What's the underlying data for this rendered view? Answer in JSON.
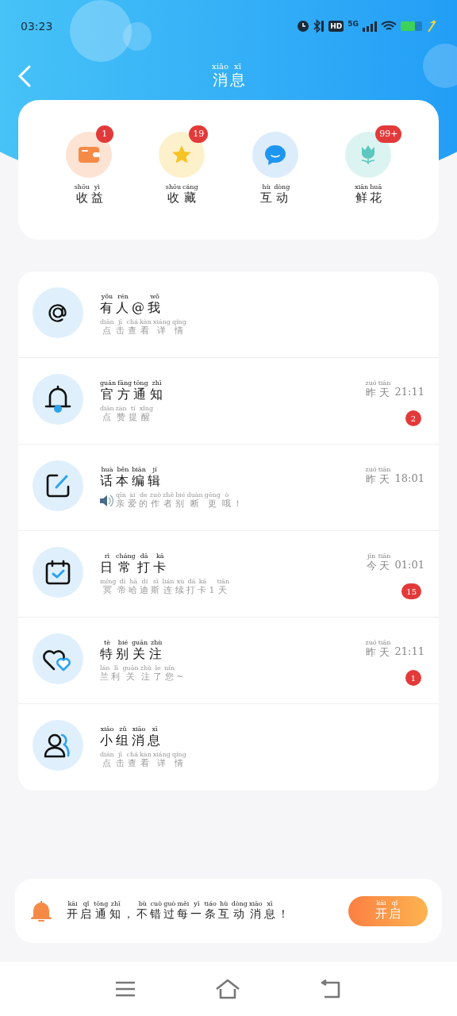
{
  "status_bar": {
    "time": "03:23",
    "hd": "HD",
    "network": "5G"
  },
  "header": {
    "title": [
      [
        "xiāo",
        "消"
      ],
      [
        "xī",
        "息"
      ]
    ]
  },
  "categories": [
    {
      "kind": "wallet",
      "label": [
        [
          "shōu",
          "收"
        ],
        [
          "yì",
          "益"
        ]
      ],
      "badge": "1"
    },
    {
      "kind": "star",
      "label": [
        [
          "shōu",
          "收"
        ],
        [
          "cáng",
          "藏"
        ]
      ],
      "badge": "19"
    },
    {
      "kind": "chat",
      "label": [
        [
          "hù",
          "互"
        ],
        [
          "dòng",
          "动"
        ]
      ]
    },
    {
      "kind": "flower",
      "label": [
        [
          "xiān",
          "鲜"
        ],
        [
          "huā",
          "花"
        ]
      ],
      "badge": "99+"
    }
  ],
  "messages": [
    {
      "kind": "at",
      "announcement": false,
      "title": [
        [
          "yǒu",
          "有"
        ],
        [
          "rén",
          "人"
        ],
        [
          "@"
        ],
        [
          "wǒ",
          "我"
        ]
      ],
      "subtitle": [
        [
          "diǎn",
          "点"
        ],
        [
          "jī",
          "击"
        ],
        [
          "chá",
          "查"
        ],
        [
          "kàn",
          "看"
        ],
        [
          "xiáng",
          "详"
        ],
        [
          "qíng",
          "情"
        ]
      ]
    },
    {
      "kind": "bell",
      "announcement": false,
      "title": [
        [
          "guān",
          "官"
        ],
        [
          "fāng",
          "方"
        ],
        [
          "tōng",
          "通"
        ],
        [
          "zhī",
          "知"
        ]
      ],
      "subtitle": [
        [
          "diǎn",
          "点"
        ],
        [
          "zàn",
          "赞"
        ],
        [
          "tí",
          "提"
        ],
        [
          "xǐng",
          "醒"
        ]
      ],
      "time": {
        "day": [
          [
            "zuó",
            "昨"
          ],
          [
            "tiān",
            "天"
          ]
        ],
        "clock": "21:11"
      },
      "badge": "2"
    },
    {
      "kind": "edit",
      "announcement": true,
      "title": [
        [
          "huà",
          "话"
        ],
        [
          "běn",
          "本"
        ],
        [
          "biān",
          "编"
        ],
        [
          "jí",
          "辑"
        ]
      ],
      "subtitle": [
        [
          "qīn",
          "亲"
        ],
        [
          "ài",
          "爱"
        ],
        [
          "de",
          "的"
        ],
        [
          "zuò",
          "作"
        ],
        [
          "zhě",
          "者"
        ],
        [
          "bié",
          "别"
        ],
        [
          "duàn",
          "断"
        ],
        [
          "gēng",
          "更"
        ],
        [
          "ò",
          "哦"
        ],
        [
          "！"
        ]
      ],
      "time": {
        "day": [
          [
            "zuó",
            "昨"
          ],
          [
            "tiān",
            "天"
          ]
        ],
        "clock": "18:01"
      }
    },
    {
      "kind": "calendar",
      "announcement": false,
      "title": [
        [
          "rì",
          "日"
        ],
        [
          "cháng",
          "常"
        ],
        [
          "dǎ",
          "打"
        ],
        [
          "kǎ",
          "卡"
        ]
      ],
      "subtitle": [
        [
          "míng",
          "冥"
        ],
        [
          "dì",
          "帝"
        ],
        [
          "hā",
          "哈"
        ],
        [
          "dí",
          "迪"
        ],
        [
          "sī",
          "斯"
        ],
        [
          "lián",
          "连"
        ],
        [
          "xù",
          "续"
        ],
        [
          "dǎ",
          "打"
        ],
        [
          "kǎ",
          "卡"
        ],
        [
          "1"
        ],
        [
          "tiān",
          "天"
        ]
      ],
      "time": {
        "day": [
          [
            "jīn",
            "今"
          ],
          [
            "tiān",
            "天"
          ]
        ],
        "clock": "01:01"
      },
      "badge": "15"
    },
    {
      "kind": "hearts",
      "announcement": false,
      "title": [
        [
          "tè",
          "特"
        ],
        [
          "bié",
          "别"
        ],
        [
          "guān",
          "关"
        ],
        [
          "zhù",
          "注"
        ]
      ],
      "subtitle": [
        [
          "lán",
          "兰"
        ],
        [
          "lì",
          "利"
        ],
        [
          "guān",
          "关"
        ],
        [
          "zhù",
          "注"
        ],
        [
          "le",
          "了"
        ],
        [
          "nín",
          "您"
        ],
        [
          "~"
        ]
      ],
      "time": {
        "day": [
          [
            "zuó",
            "昨"
          ],
          [
            "tiān",
            "天"
          ]
        ],
        "clock": "21:11"
      },
      "badge": "1"
    },
    {
      "kind": "group",
      "announcement": false,
      "title": [
        [
          "xiǎo",
          "小"
        ],
        [
          "zǔ",
          "组"
        ],
        [
          "xiāo",
          "消"
        ],
        [
          "xī",
          "息"
        ]
      ],
      "subtitle": [
        [
          "diǎn",
          "点"
        ],
        [
          "jī",
          "击"
        ],
        [
          "chá",
          "查"
        ],
        [
          "kàn",
          "看"
        ],
        [
          "xiáng",
          "详"
        ],
        [
          "qíng",
          "情"
        ]
      ]
    }
  ],
  "banner": {
    "text": [
      [
        "kāi",
        "开"
      ],
      [
        "qǐ",
        "启"
      ],
      [
        "tōng",
        "通"
      ],
      [
        "zhī",
        "知"
      ],
      [
        "，"
      ],
      [
        "bù",
        "不"
      ],
      [
        "cuò",
        "错"
      ],
      [
        "guò",
        "过"
      ],
      [
        "měi",
        "每"
      ],
      [
        "yī",
        "一"
      ],
      [
        "tiáo",
        "条"
      ],
      [
        "hù",
        "互"
      ],
      [
        "dòng",
        "动"
      ],
      [
        "xiāo",
        "消"
      ],
      [
        "xī",
        "息"
      ],
      [
        "！"
      ]
    ],
    "button": [
      [
        "kāi",
        "开"
      ],
      [
        "qǐ",
        "启"
      ]
    ]
  }
}
